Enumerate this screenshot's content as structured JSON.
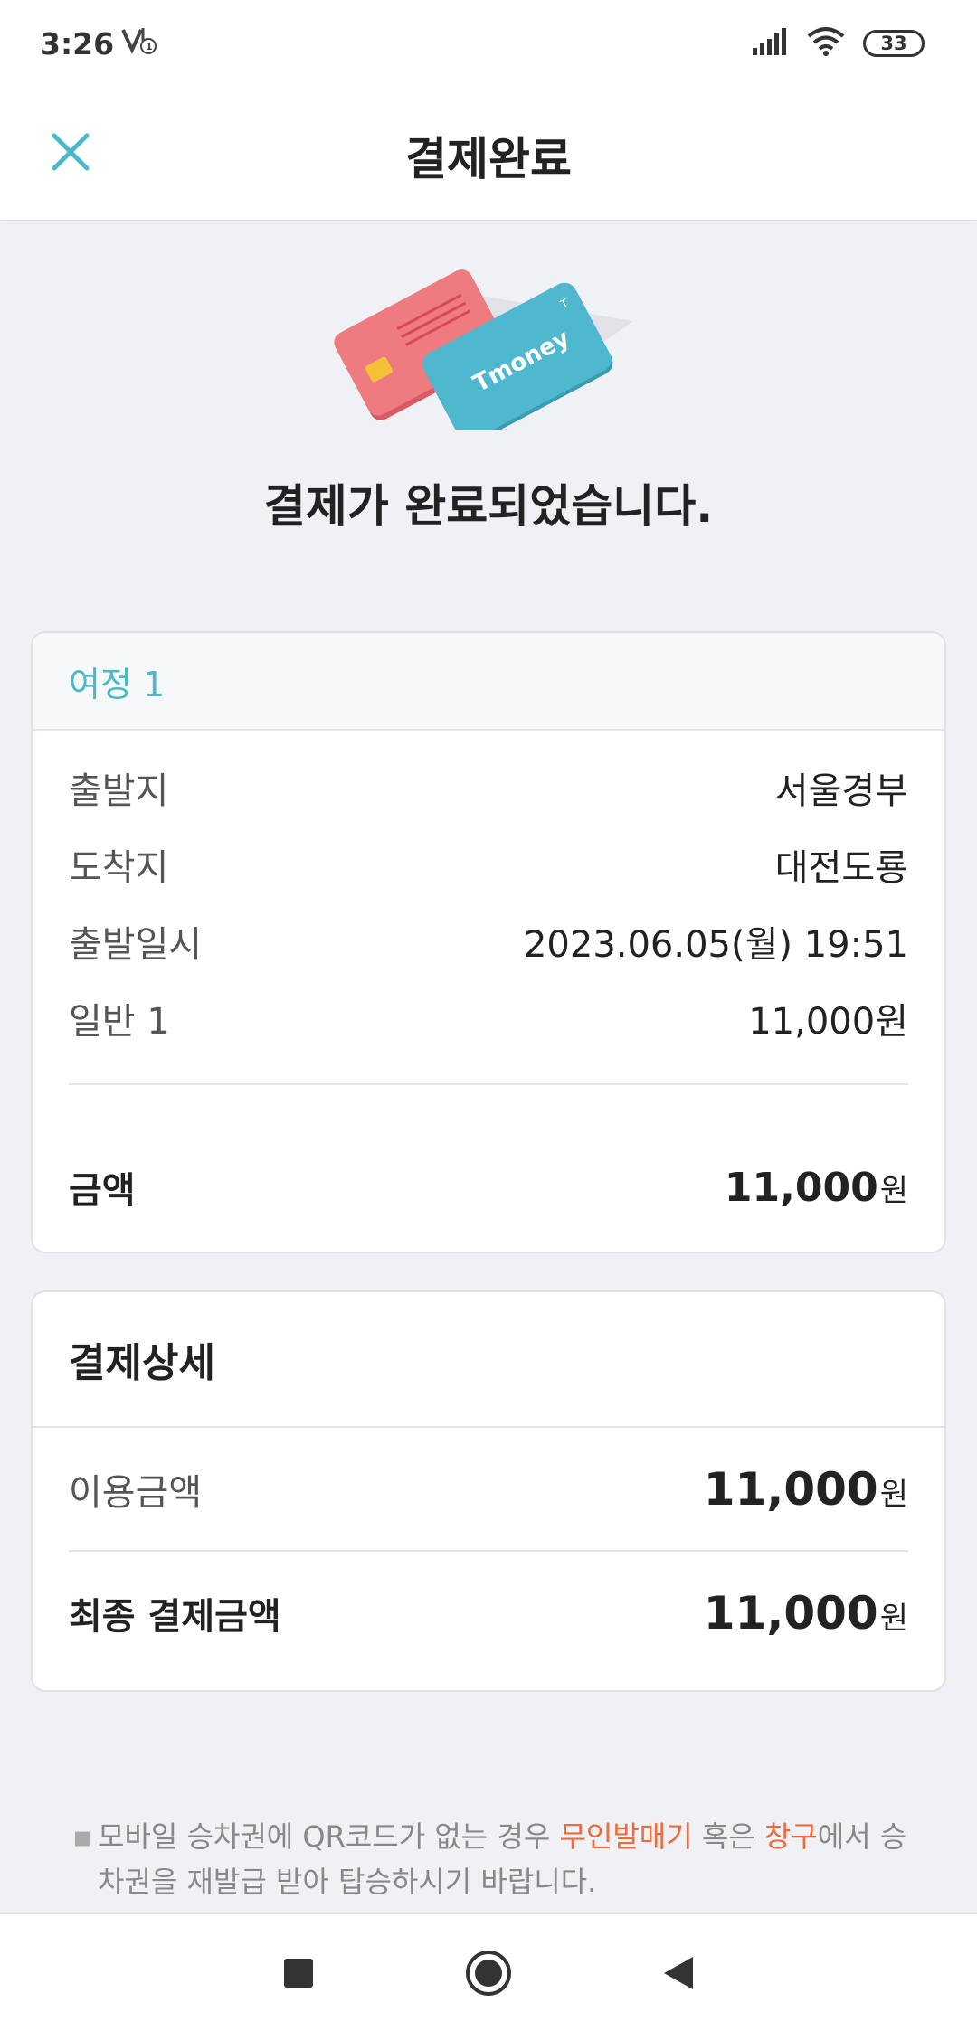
{
  "status_bar": {
    "time": "3:26",
    "battery": "33",
    "icons": [
      "volte-icon",
      "signal-icon",
      "wifi-icon",
      "battery-icon"
    ]
  },
  "header": {
    "title": "결제완료",
    "close_icon": "close-icon"
  },
  "hero": {
    "card_brand": "Tmoney",
    "message": "결제가 완료되었습니다."
  },
  "trip": {
    "title": "여정 1",
    "rows": [
      {
        "label": "출발지",
        "value": "서울경부"
      },
      {
        "label": "도착지",
        "value": "대전도룡"
      },
      {
        "label": "출발일시",
        "value": "2023.06.05(월) 19:51"
      },
      {
        "label": "일반 1",
        "value": "11,000원"
      }
    ],
    "total_label": "금액",
    "total_amount": "11,000",
    "currency": "원"
  },
  "payment_detail": {
    "title": "결제상세",
    "usage_label": "이용금액",
    "usage_amount": "11,000",
    "final_label": "최종 결제금액",
    "final_amount": "11,000",
    "currency": "원"
  },
  "notice": {
    "bullet": "▪",
    "part1": "모바일 승차권에 QR코드가 없는 경우 ",
    "highlight1": "무인발매기",
    "part2": " 혹은 ",
    "highlight2": "창구",
    "part3": "에서 승차권을 재발급 받아 탑승하시기 바랍니다."
  },
  "colors": {
    "accent": "#4cb9c8",
    "highlight": "#ef6a3f",
    "card_red": "#ee7b80",
    "card_teal": "#4fb8cf"
  },
  "nav": {
    "icons": [
      "recents-icon",
      "home-icon",
      "back-icon"
    ]
  }
}
